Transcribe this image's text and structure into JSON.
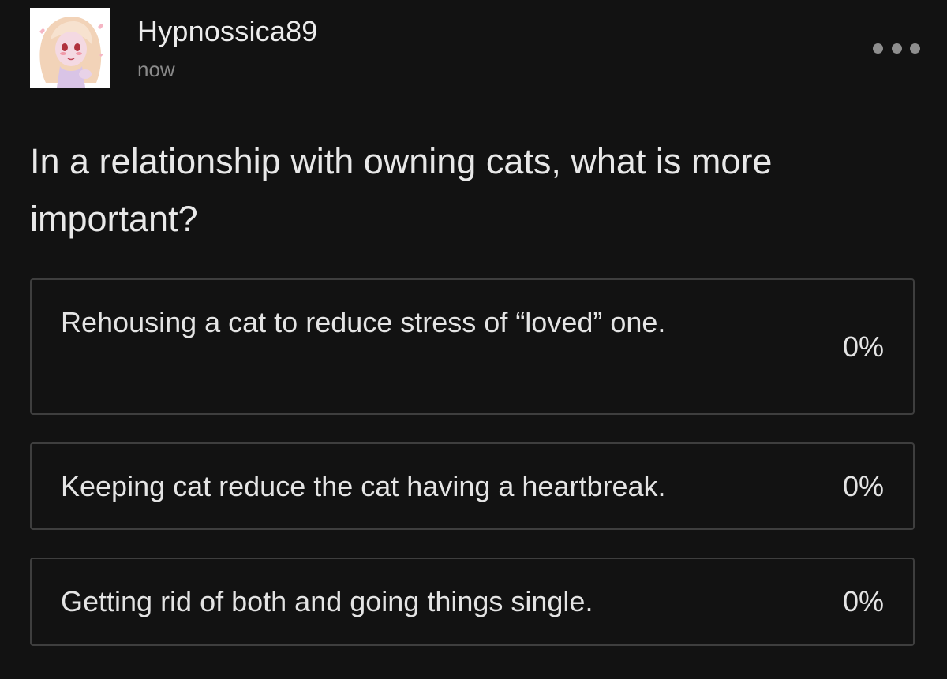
{
  "post": {
    "author": "Hypnossica89",
    "timestamp": "now",
    "more_icon": "more-horizontal-icon",
    "question": "In a relationship with owning cats, what is more important?"
  },
  "poll": {
    "options": [
      {
        "label": "Rehousing a cat to reduce stress of “loved” one.",
        "percent": "0%"
      },
      {
        "label": "Keeping cat reduce the cat having a heartbreak.",
        "percent": "0%"
      },
      {
        "label": "Getting rid of both and going things single.",
        "percent": "0%"
      }
    ]
  },
  "colors": {
    "background": "#121212",
    "text": "#e6e6e6",
    "muted": "#8a8a8a",
    "border": "#3e3e3e"
  }
}
